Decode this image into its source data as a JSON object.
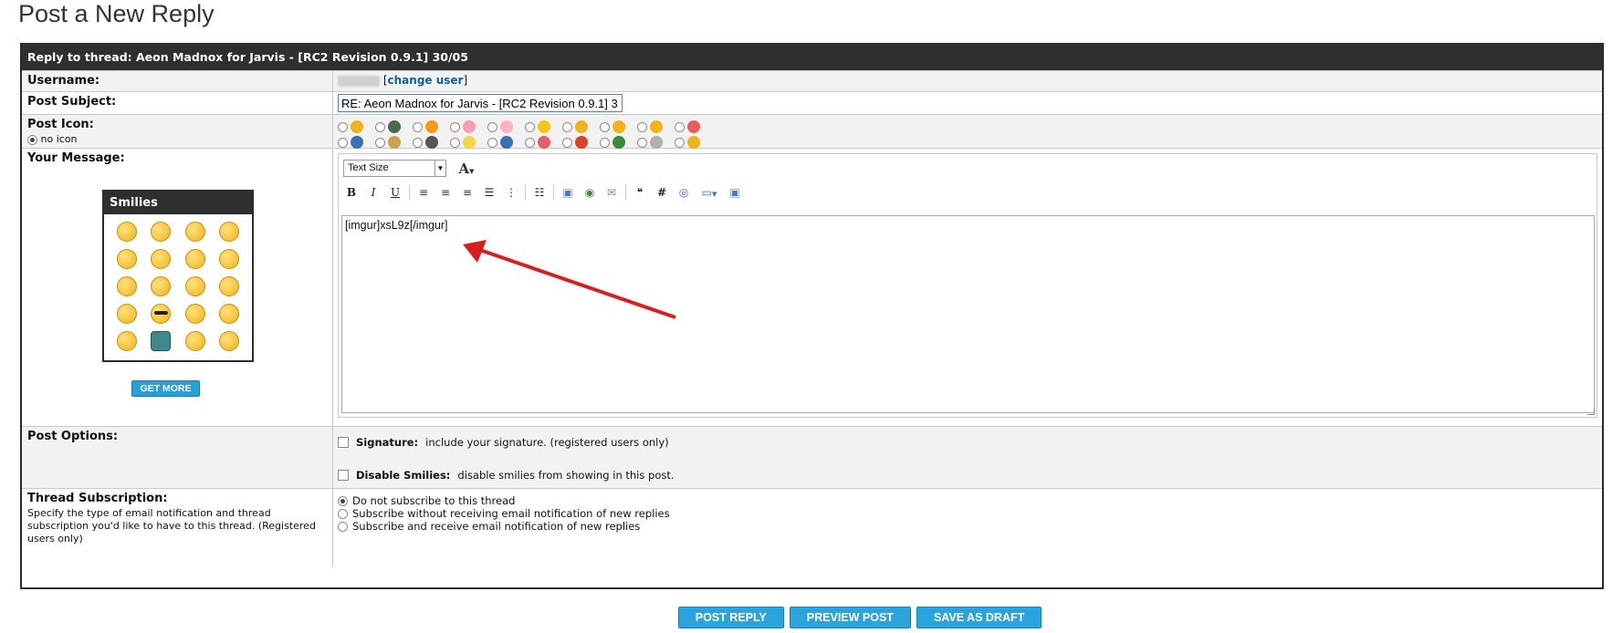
{
  "page": {
    "title": "Post a New Reply"
  },
  "thread": {
    "header": "Reply to thread: Aeon Madnox for Jarvis - [RC2 Revision 0.9.1] 30/05"
  },
  "username": {
    "label": "Username:",
    "change_user": "change user"
  },
  "subject": {
    "label": "Post Subject:",
    "value": "RE: Aeon Madnox for Jarvis - [RC2 Revision 0.9.1] 3"
  },
  "post_icon": {
    "label": "Post Icon:",
    "no_icon": "no icon",
    "icons": [
      {
        "name": "smile-icon",
        "color": "#f1b21b"
      },
      {
        "name": "film-icon",
        "color": "#4a6b4a"
      },
      {
        "name": "tongue-icon",
        "color": "#f39c12"
      },
      {
        "name": "hand-icon",
        "color": "#f5a0b0"
      },
      {
        "name": "heart-outline-icon",
        "color": "#f7b3c2"
      },
      {
        "name": "star-icon",
        "color": "#f5c518"
      },
      {
        "name": "grin-icon",
        "color": "#f1b21b"
      },
      {
        "name": "angel-icon",
        "color": "#f1b21b"
      },
      {
        "name": "cool-icon",
        "color": "#f1b21b"
      },
      {
        "name": "rainbow-icon",
        "color": "#e85d5d"
      },
      {
        "name": "question-icon",
        "color": "#3b6fb5"
      },
      {
        "name": "picture-icon",
        "color": "#c9a24b"
      },
      {
        "name": "music-icon",
        "color": "#555555"
      },
      {
        "name": "lightbulb-icon",
        "color": "#f5d34b"
      },
      {
        "name": "info-icon",
        "color": "#3b6fb5"
      },
      {
        "name": "heart-icon",
        "color": "#e85d6a"
      },
      {
        "name": "exclamation-icon",
        "color": "#d9432b"
      },
      {
        "name": "bug-icon",
        "color": "#3a8a3a"
      },
      {
        "name": "cube-icon",
        "color": "#b0b0b0"
      },
      {
        "name": "sleepy-icon",
        "color": "#f1b21b"
      }
    ]
  },
  "message": {
    "label": "Your Message:",
    "smilies_title": "Smilies",
    "get_more": "GET MORE",
    "text_size": "Text Size",
    "body": "[imgur]xsL9z[/imgur]"
  },
  "post_options": {
    "label": "Post Options:",
    "signature_title": "Signature:",
    "signature_desc": "include your signature. (registered users only)",
    "smilies_title": "Disable Smilies:",
    "smilies_desc": "disable smilies from showing in this post."
  },
  "subscription": {
    "label": "Thread Subscription:",
    "desc": "Specify the type of email notification and thread subscription you'd like to have to this thread. (Registered users only)",
    "options": [
      "Do not subscribe to this thread",
      "Subscribe without receiving email notification of new replies",
      "Subscribe and receive email notification of new replies"
    ]
  },
  "buttons": {
    "post_reply": "POST REPLY",
    "preview": "PREVIEW POST",
    "draft": "SAVE AS DRAFT"
  },
  "colors": {
    "accent": "#2aa4dd",
    "header_bg": "#2f2f2f",
    "link": "#1a5d91",
    "annotation_arrow": "#d62020"
  }
}
